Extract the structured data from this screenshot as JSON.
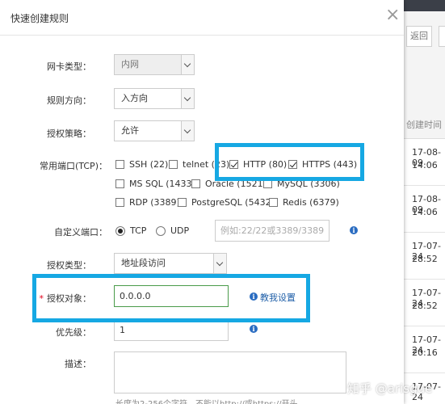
{
  "background": {
    "back_label": "返回",
    "time_header": "创建时间",
    "rows": [
      {
        "date": "17-08-09",
        "time": "14:06"
      },
      {
        "date": "17-08-09",
        "time": "14:06"
      },
      {
        "date": "17-07-24",
        "time": "28:52"
      },
      {
        "date": "17-07-24",
        "time": "28:52"
      },
      {
        "date": "17-07-24",
        "time": "20:16"
      },
      {
        "date": "17-07-24",
        "time": ""
      }
    ]
  },
  "dialog": {
    "title": "快速创建规则",
    "close_symbol": "×",
    "nic_type": {
      "label": "网卡类型：",
      "value": "内网"
    },
    "direction": {
      "label": "规则方向：",
      "value": "入方向"
    },
    "policy": {
      "label": "授权策略：",
      "value": "允许"
    },
    "common_ports": {
      "label": "常用端口(TCP)：",
      "options": [
        {
          "label": "SSH (22)",
          "checked": false
        },
        {
          "label": "telnet (23)",
          "checked": false
        },
        {
          "label": "HTTP (80)",
          "checked": true
        },
        {
          "label": "HTTPS (443)",
          "checked": true
        },
        {
          "label": "MS SQL (1433)",
          "checked": false
        },
        {
          "label": "Oracle (1521)",
          "checked": false
        },
        {
          "label": "MySQL (3306)",
          "checked": false
        },
        {
          "label": "RDP (3389)",
          "checked": false
        },
        {
          "label": "PostgreSQL (5432)",
          "checked": false
        },
        {
          "label": "Redis (6379)",
          "checked": false
        }
      ]
    },
    "custom_port": {
      "label": "自定义端口：",
      "protocols": [
        {
          "label": "TCP",
          "selected": true
        },
        {
          "label": "UDP",
          "selected": false
        }
      ],
      "placeholder": "例如:22/22或3389/3389"
    },
    "auth_type": {
      "label": "授权类型：",
      "value": "地址段访问"
    },
    "auth_object": {
      "label": "授权对象：",
      "required_mark": "*",
      "value": "0.0.0.0",
      "help_link": "教我设置"
    },
    "priority": {
      "label": "优先级：",
      "value": "1"
    },
    "description": {
      "label": "描述：",
      "value": ""
    },
    "help_text": "长度为2-256个字符，不能以http://或https://开头"
  },
  "watermark": "知乎 @arisgue",
  "colors": {
    "highlight": "#16a8e3",
    "link": "#1f5fa8",
    "required": "#e0001a",
    "info": "#2a6cc1"
  }
}
